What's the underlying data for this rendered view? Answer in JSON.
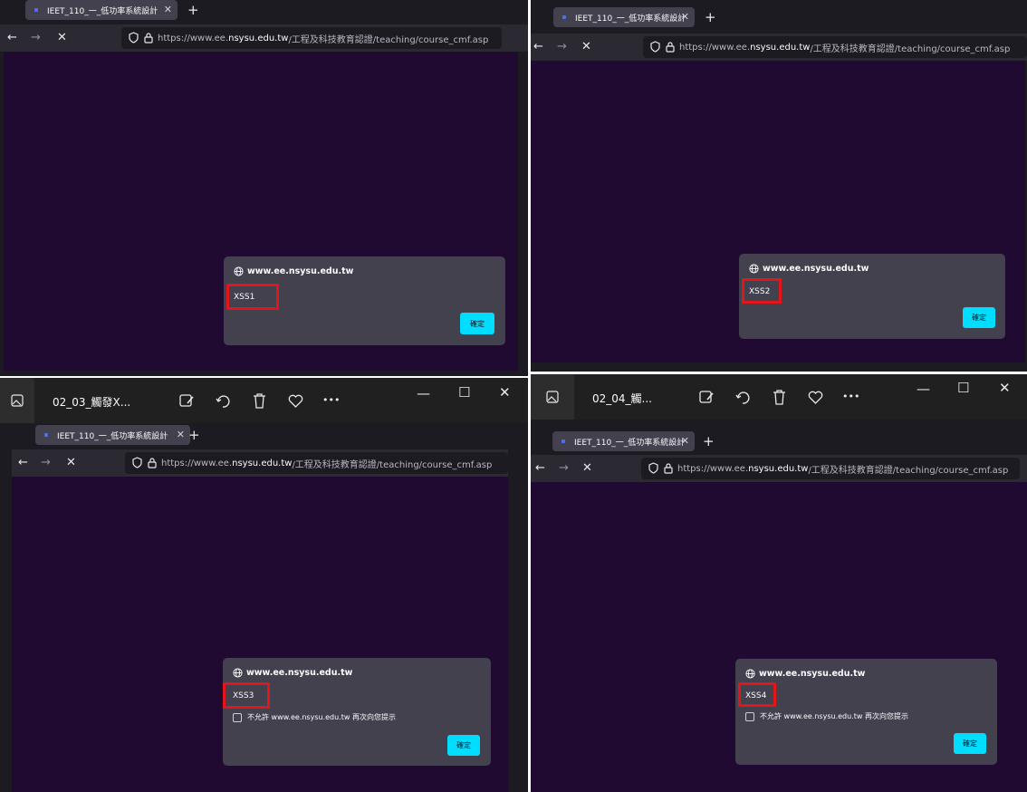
{
  "browser": {
    "tab_title": "IEET_110_一_低功率系統設計",
    "url_prefix": "https://www.ee.",
    "url_domain": "nsysu.edu.tw",
    "url_path": "/工程及科技教育認證/teaching/course_cmf.asp",
    "new_tab": "+",
    "tab_close": "✕",
    "back": "←",
    "forward": "→",
    "stop": "✕"
  },
  "dialog": {
    "origin": "www.ee.nsysu.edu.tw",
    "ok_label": "確定",
    "suppress_label": "不允許 www.ee.nsysu.edu.tw 再次向您提示"
  },
  "alerts": {
    "xss1": "XSS1",
    "xss2": "XSS2",
    "xss3": "XSS3",
    "xss4": "XSS4"
  },
  "photos_viewer": {
    "window3_title": "02_03_觸發X...",
    "window4_title": "02_04_觸...",
    "minimize": "—",
    "maximize": "☐",
    "close": "✕",
    "more": "•••"
  },
  "colors": {
    "page_bg": "#200a31",
    "dialog_bg": "#42414d",
    "ok_button": "#00ddff",
    "highlight": "#e0161b",
    "toolbar": "#2b2a33",
    "tabstrip": "#1c1b22"
  }
}
